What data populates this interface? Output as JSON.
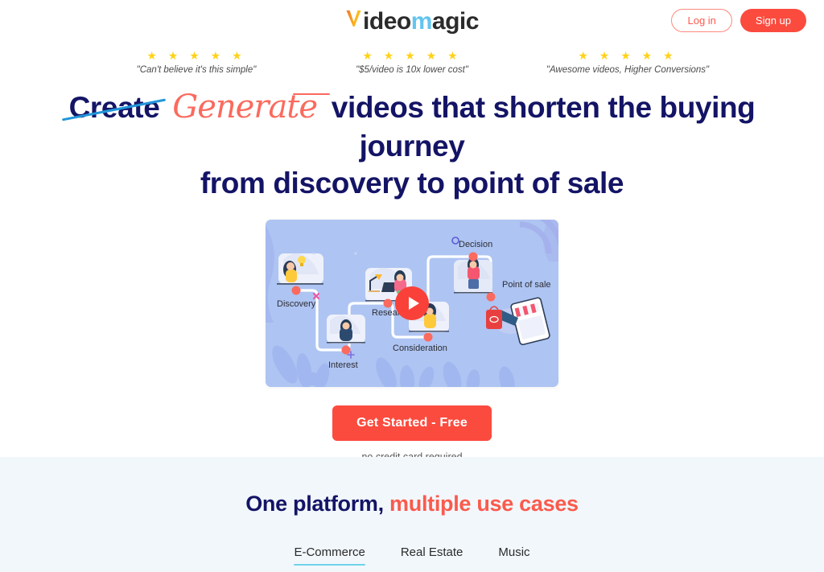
{
  "header": {
    "logo": {
      "v": "V",
      "part1": "ideo",
      "m": "m",
      "part2": "agic"
    },
    "login_label": "Log in",
    "signup_label": "Sign up"
  },
  "testimonials": [
    {
      "stars": "★ ★ ★ ★ ★",
      "quote": "\"Can't believe it's this simple\""
    },
    {
      "stars": "★ ★ ★ ★ ★",
      "quote": "\"$5/video is 10x lower cost\""
    },
    {
      "stars": "★ ★ ★ ★ ★",
      "quote": "\"Awesome videos, Higher Conversions\""
    }
  ],
  "hero": {
    "struck_word": "Create",
    "script_word": "Generate",
    "headline_rest": "videos that shorten the buying journey",
    "headline_line2": "from discovery to point of sale",
    "cta_label": "Get Started - Free",
    "cta_note": "no credit card required"
  },
  "video": {
    "nodes": [
      {
        "label": "Discovery"
      },
      {
        "label": "Interest"
      },
      {
        "label": "Research"
      },
      {
        "label": "Consideration"
      },
      {
        "label": "Decision"
      },
      {
        "label": "Point of sale"
      }
    ],
    "play_icon": "play-icon"
  },
  "section2": {
    "title_navy": "One platform,",
    "title_coral": "multiple use cases",
    "tabs": [
      {
        "label": "E-Commerce",
        "active": true
      },
      {
        "label": "Real Estate",
        "active": false
      },
      {
        "label": "Music",
        "active": false
      }
    ]
  },
  "colors": {
    "coral": "#fb4b3e",
    "navy": "#141466",
    "star_yellow": "#ffd218",
    "tab_underline": "#6fd4ea",
    "strike_blue": "#2196d9",
    "section_bg": "#f2f7fc",
    "video_bg": "#aec4f2"
  }
}
